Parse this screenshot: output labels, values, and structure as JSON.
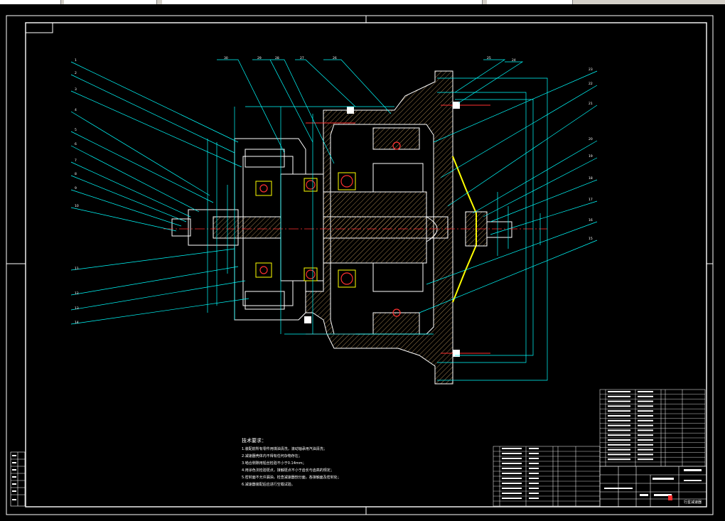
{
  "colors": {
    "background": "#000000",
    "frame": "#ffffff",
    "leader": "#00ffff",
    "section": "#ffff00",
    "hatch": "#c8a060",
    "centerline": "#ff0000"
  },
  "drawing": {
    "part_numbers_left": [
      "1",
      "2",
      "3",
      "4",
      "5",
      "6",
      "7",
      "8",
      "9",
      "10",
      "11",
      "12",
      "13",
      "14"
    ],
    "part_numbers_top": [
      "30",
      "29",
      "28",
      "27",
      "26",
      "25",
      "24"
    ],
    "part_numbers_right": [
      "23",
      "22",
      "21",
      "20",
      "19",
      "18",
      "17",
      "16",
      "15"
    ]
  },
  "notes": {
    "title": "技术要求：",
    "lines": [
      "1.装配前所有零件用煤油清洗，滚动轴承用汽油清洗；",
      "2.减速器壳体内不得有任何杂物存在；",
      "3.啮合侧隙用铅丝检验不小于0.14mm；",
      "4.用涂色法检验斑点，接触斑点不小于齿长与齿高的规定；",
      "5.密封面不允许漏油，检查减速器剖分面，各接触面及密封处；",
      "6.减速器装配后应进行空载试验。"
    ]
  },
  "title_block": {
    "drawing_name": "行星减速器"
  }
}
